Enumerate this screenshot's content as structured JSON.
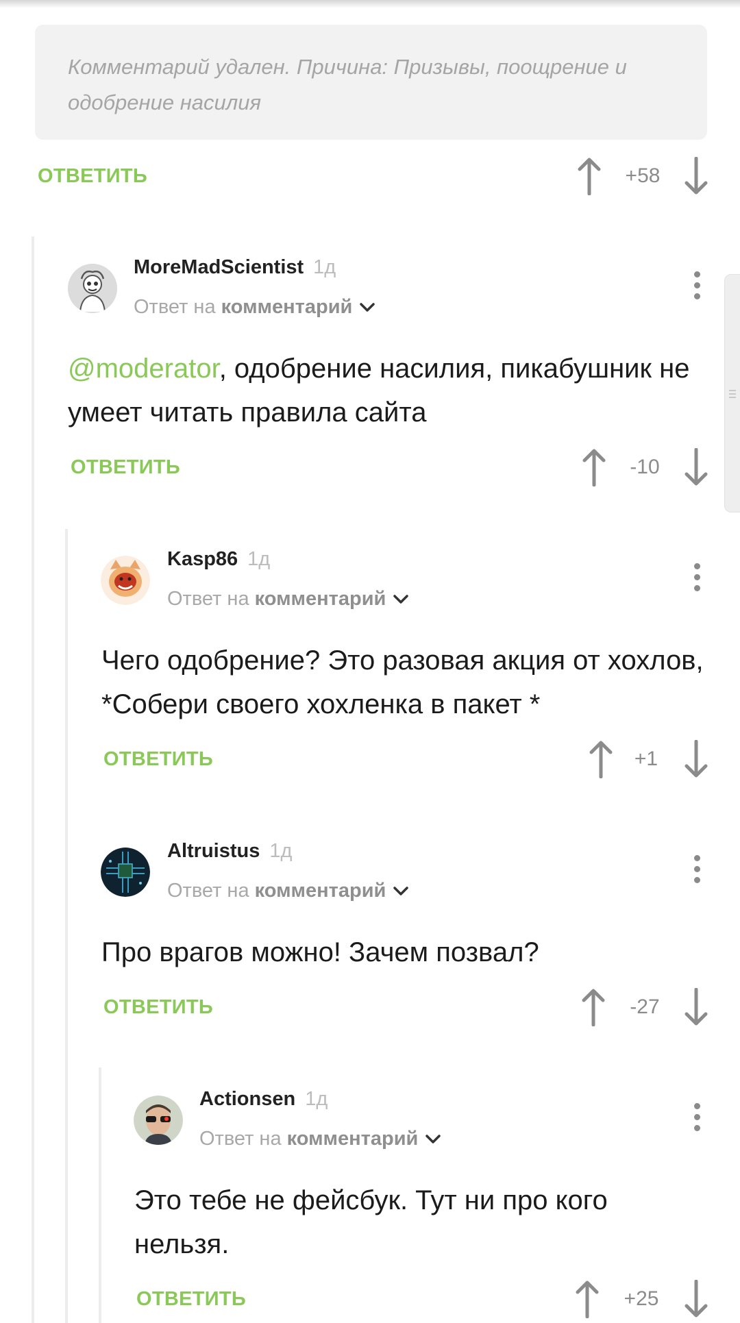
{
  "deleted_comment": {
    "text": "Комментарий удален. Причина: Призывы, поощрение и одобрение насилия",
    "reply_label": "ОТВЕТИТЬ",
    "score": "+58"
  },
  "comments": [
    {
      "username": "MoreMadScientist",
      "time": "1д",
      "reply_prefix": "Ответ на",
      "reply_target": "комментарий",
      "mention": "@moderator",
      "text": ", одобрение насилия, пикабушник не умеет читать правила сайта",
      "reply_label": "ОТВЕТИТЬ",
      "score": "-10"
    },
    {
      "username": "Kasp86",
      "time": "1д",
      "reply_prefix": "Ответ на",
      "reply_target": "комментарий",
      "text": "Чего одобрение? Это разовая акция от хохлов, *Собери своего хохленка в пакет *",
      "reply_label": "ОТВЕТИТЬ",
      "score": "+1"
    },
    {
      "username": "Altruistus",
      "time": "1д",
      "reply_prefix": "Ответ на",
      "reply_target": "комментарий",
      "text": "Про врагов можно! Зачем позвал?",
      "reply_label": "ОТВЕТИТЬ",
      "score": "-27"
    },
    {
      "username": "Actionsen",
      "time": "1д",
      "reply_prefix": "Ответ на",
      "reply_target": "комментарий",
      "text": "Это тебе не фейсбук. Тут ни про кого нельзя.",
      "reply_label": "ОТВЕТИТЬ",
      "score": "+25"
    }
  ],
  "colors": {
    "accent_green": "#8ac858",
    "muted_gray": "#8b8b8b",
    "deleted_bg": "#f2f2f2"
  },
  "icons": [
    "arrow-up-icon",
    "arrow-down-icon",
    "more-icon",
    "chevron-down-icon"
  ]
}
